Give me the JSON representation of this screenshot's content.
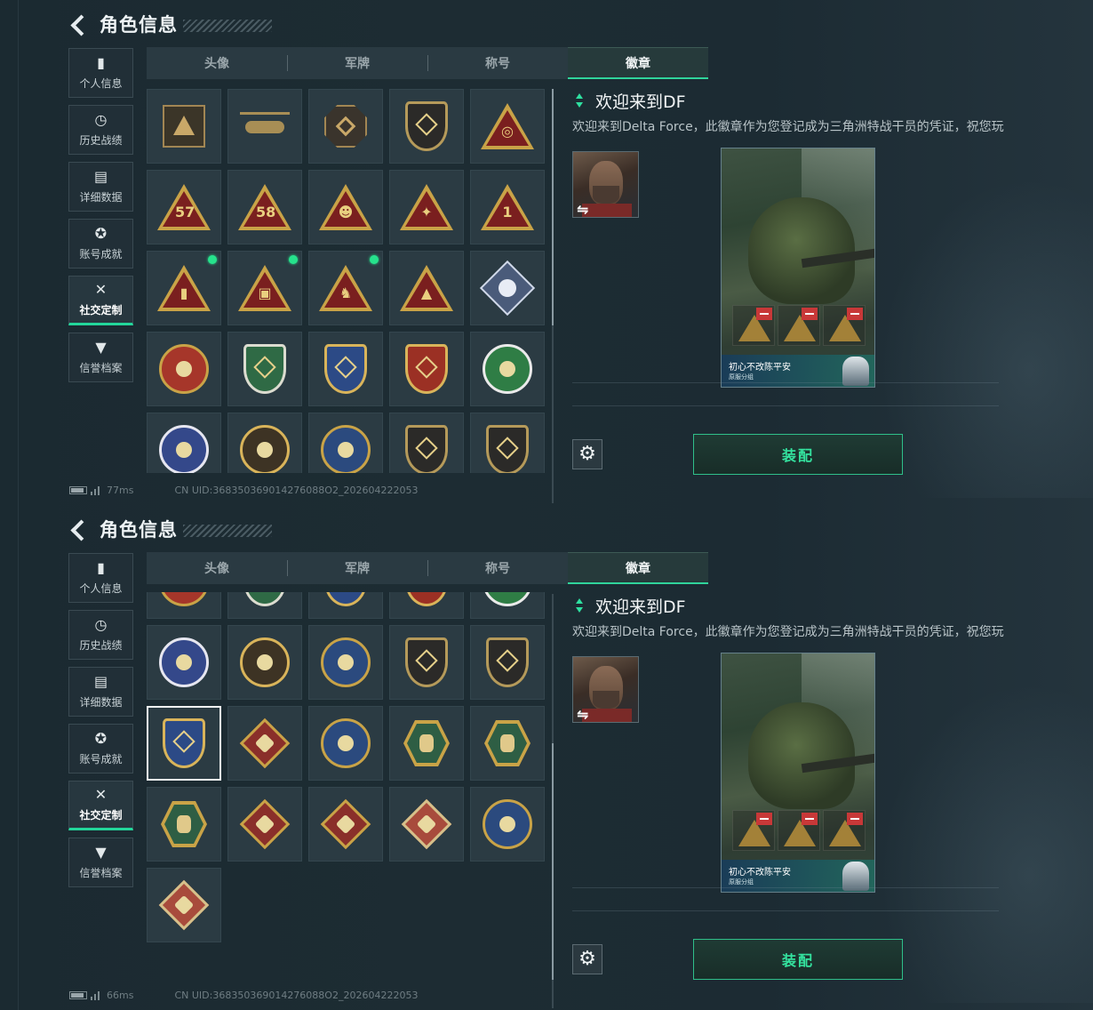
{
  "screens": [
    {
      "title": "角色信息",
      "sidebar": [
        {
          "label": "个人信息",
          "icon": "bar-chart-icon"
        },
        {
          "label": "历史战绩",
          "icon": "clock-icon"
        },
        {
          "label": "详细数据",
          "icon": "folder-icon"
        },
        {
          "label": "账号成就",
          "icon": "medal-icon"
        },
        {
          "label": "社交定制",
          "icon": "tools-icon",
          "active": true
        },
        {
          "label": "信誉档案",
          "icon": "shield-check-icon"
        }
      ],
      "tabs": [
        {
          "label": "头像"
        },
        {
          "label": "军牌"
        },
        {
          "label": "称号"
        },
        {
          "label": "徽章",
          "active": true
        }
      ],
      "badge_grid_scroll": "top",
      "selected_badge": "welcome-to-df",
      "detail": {
        "title": "欢迎来到DF",
        "description": "欢迎来到Delta Force，此徽章作为您登记成为三角洲特战干员的凭证，祝您玩"
      },
      "card": {
        "name": "初心不改陈平安",
        "sub": "原服分组"
      },
      "equip_label": "装配",
      "status": {
        "latency": "77ms",
        "uid": "CN UID:368350369014276088O2_202604222053"
      }
    },
    {
      "title": "角色信息",
      "sidebar": [
        {
          "label": "个人信息",
          "icon": "bar-chart-icon"
        },
        {
          "label": "历史战绩",
          "icon": "clock-icon"
        },
        {
          "label": "详细数据",
          "icon": "folder-icon"
        },
        {
          "label": "账号成就",
          "icon": "medal-icon"
        },
        {
          "label": "社交定制",
          "icon": "tools-icon",
          "active": true
        },
        {
          "label": "信誉档案",
          "icon": "shield-check-icon"
        }
      ],
      "tabs": [
        {
          "label": "头像"
        },
        {
          "label": "军牌"
        },
        {
          "label": "称号"
        },
        {
          "label": "徽章",
          "active": true
        }
      ],
      "badge_grid_scroll": "bottom",
      "selected_badge": "gold-shield-crosshair",
      "detail": {
        "title": "欢迎来到DF",
        "description": "欢迎来到Delta Force，此徽章作为您登记成为三角洲特战干员的凭证，祝您玩"
      },
      "card": {
        "name": "初心不改陈平安",
        "sub": "原服分组"
      },
      "equip_label": "装配",
      "status": {
        "latency": "66ms",
        "uid": "CN UID:368350369014276088O2_202604222053"
      }
    }
  ],
  "badges": [
    {
      "name": "delta-badge",
      "shape": "delta",
      "new": false
    },
    {
      "name": "helicopter-badge",
      "shape": "heli",
      "new": false
    },
    {
      "name": "octagon-badge",
      "shape": "octa",
      "new": false
    },
    {
      "name": "dagger-shield-badge",
      "shape": "shield-dark",
      "new": false
    },
    {
      "name": "gyro-triangle-badge",
      "shape": "tri",
      "glyph": "◎",
      "new": false
    },
    {
      "name": "ticket-57-badge",
      "shape": "tri",
      "glyph": "57",
      "new": false
    },
    {
      "name": "ticket-58-badge",
      "shape": "tri",
      "glyph": "58",
      "new": false
    },
    {
      "name": "operator-triangle-badge",
      "shape": "tri",
      "glyph": "☻",
      "new": false
    },
    {
      "name": "wings-triangle-badge",
      "shape": "tri",
      "glyph": "✦",
      "new": false
    },
    {
      "name": "number-one-badge",
      "shape": "tri",
      "glyph": "1",
      "new": false
    },
    {
      "name": "drive-triangle-badge",
      "shape": "tri",
      "glyph": "▮",
      "new": true
    },
    {
      "name": "card-triangle-badge",
      "shape": "tri",
      "glyph": "▣",
      "new": true
    },
    {
      "name": "squad-triangle-badge",
      "shape": "tri",
      "glyph": "♞",
      "new": true
    },
    {
      "name": "rocket-triangle-badge",
      "shape": "tri",
      "glyph": "▲",
      "new": false
    },
    {
      "name": "rose-diamond-badge",
      "shape": "gem",
      "new": false
    },
    {
      "name": "sun-star-badge",
      "shape": "circle-red",
      "new": false
    },
    {
      "name": "green-shield-badge",
      "shape": "shield-green",
      "new": false
    },
    {
      "name": "blue-shield-badge",
      "shape": "shield-blue",
      "new": false
    },
    {
      "name": "red-shield-badge",
      "shape": "shield-red",
      "new": false
    },
    {
      "name": "skull-crosshair-badge",
      "shape": "circle-green",
      "new": false
    },
    {
      "name": "tiger-crest-badge",
      "shape": "circle-blue",
      "new": false
    },
    {
      "name": "sunburst-badge",
      "shape": "circle-sun",
      "new": false
    },
    {
      "name": "crossed-target-badge",
      "shape": "circle-navy",
      "new": false
    },
    {
      "name": "rifle-shield-badge",
      "shape": "shield-dark",
      "new": false
    },
    {
      "name": "sniper-shield-badge",
      "shape": "shield-dark",
      "new": false
    },
    {
      "name": "gold-shield-crosshair",
      "shape": "shield-blue",
      "new": false
    },
    {
      "name": "wolf-diamond-badge",
      "shape": "diamond-red",
      "new": false
    },
    {
      "name": "eagle-circle-badge",
      "shape": "circle-navy",
      "new": false
    },
    {
      "name": "wasp-hex-badge",
      "shape": "hex",
      "new": false
    },
    {
      "name": "medic-hex-badge",
      "shape": "hex",
      "new": false
    },
    {
      "name": "operator-hex-badge",
      "shape": "hex",
      "new": false
    },
    {
      "name": "dragon-diamond-badge",
      "shape": "diamond-red",
      "new": false
    },
    {
      "name": "dragon-red-diamond-badge",
      "shape": "diamond-red",
      "new": false
    },
    {
      "name": "runner-diamond-badge",
      "shape": "diamond-tan",
      "new": false
    },
    {
      "name": "lynx-circle-badge",
      "shape": "circle-navy",
      "new": false
    },
    {
      "name": "tools-diamond-badge",
      "shape": "diamond-tan",
      "new": false
    }
  ],
  "colors": {
    "accent": "#2ee0a0",
    "new_dot": "#26e28c",
    "panel_bg": "#1c2b33"
  }
}
